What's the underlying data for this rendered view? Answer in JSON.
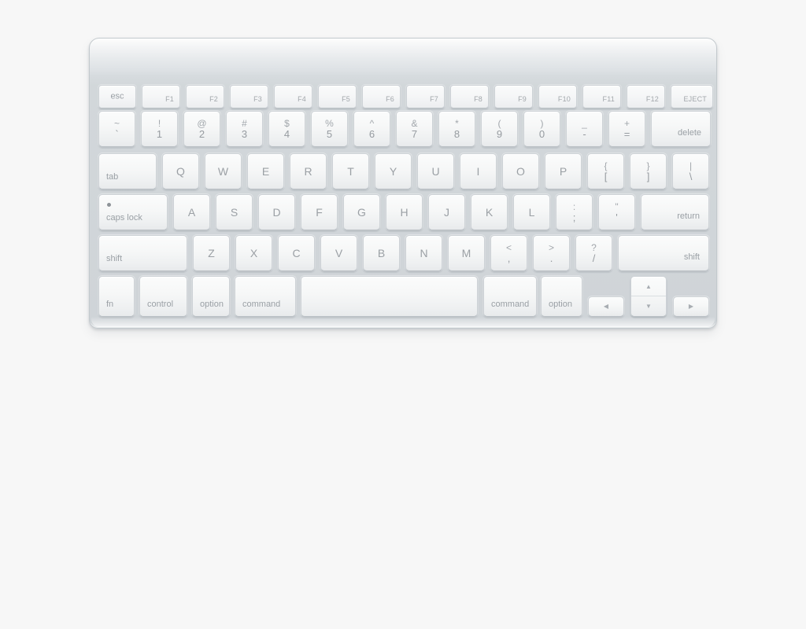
{
  "device": {
    "name": "apple-wireless-keyboard",
    "layout": "us-ansi-compact",
    "body_color": "#d2d7da",
    "key_color": "#f6f7f7",
    "legend_color": "#9aa0a5",
    "page_background": "#f7f7f7"
  },
  "rows": {
    "function_row": [
      {
        "name": "esc",
        "label": "esc",
        "style": "mid"
      },
      {
        "name": "f1",
        "label": "F1",
        "style": "br"
      },
      {
        "name": "f2",
        "label": "F2",
        "style": "br"
      },
      {
        "name": "f3",
        "label": "F3",
        "style": "br"
      },
      {
        "name": "f4",
        "label": "F4",
        "style": "br"
      },
      {
        "name": "f5",
        "label": "F5",
        "style": "br"
      },
      {
        "name": "f6",
        "label": "F6",
        "style": "br"
      },
      {
        "name": "f7",
        "label": "F7",
        "style": "br"
      },
      {
        "name": "f8",
        "label": "F8",
        "style": "br"
      },
      {
        "name": "f9",
        "label": "F9",
        "style": "br"
      },
      {
        "name": "f10",
        "label": "F10",
        "style": "br"
      },
      {
        "name": "f11",
        "label": "F11",
        "style": "br"
      },
      {
        "name": "f12",
        "label": "F12",
        "style": "br"
      },
      {
        "name": "eject",
        "label": "EJECT",
        "style": "br"
      }
    ],
    "number_row": [
      {
        "name": "backtick",
        "top": "~",
        "bottom": "`"
      },
      {
        "name": "digit-1",
        "top": "!",
        "bottom": "1"
      },
      {
        "name": "digit-2",
        "top": "@",
        "bottom": "2"
      },
      {
        "name": "digit-3",
        "top": "#",
        "bottom": "3"
      },
      {
        "name": "digit-4",
        "top": "$",
        "bottom": "4"
      },
      {
        "name": "digit-5",
        "top": "%",
        "bottom": "5"
      },
      {
        "name": "digit-6",
        "top": "^",
        "bottom": "6"
      },
      {
        "name": "digit-7",
        "top": "&",
        "bottom": "7"
      },
      {
        "name": "digit-8",
        "top": "*",
        "bottom": "8"
      },
      {
        "name": "digit-9",
        "top": "(",
        "bottom": "9"
      },
      {
        "name": "digit-0",
        "top": ")",
        "bottom": "0"
      },
      {
        "name": "minus",
        "top": "_",
        "bottom": "-"
      },
      {
        "name": "equals",
        "top": "+",
        "bottom": "="
      },
      {
        "name": "delete",
        "label": "delete",
        "style": "brw"
      }
    ],
    "top_row": [
      {
        "name": "tab",
        "label": "tab",
        "style": "bl"
      },
      {
        "name": "key-q",
        "label": "Q",
        "style": "center"
      },
      {
        "name": "key-w",
        "label": "W",
        "style": "center"
      },
      {
        "name": "key-e",
        "label": "E",
        "style": "center"
      },
      {
        "name": "key-r",
        "label": "R",
        "style": "center"
      },
      {
        "name": "key-t",
        "label": "T",
        "style": "center"
      },
      {
        "name": "key-y",
        "label": "Y",
        "style": "center"
      },
      {
        "name": "key-u",
        "label": "U",
        "style": "center"
      },
      {
        "name": "key-i",
        "label": "I",
        "style": "center"
      },
      {
        "name": "key-o",
        "label": "O",
        "style": "center"
      },
      {
        "name": "key-p",
        "label": "P",
        "style": "center"
      },
      {
        "name": "bracket-left",
        "top": "{",
        "bottom": "["
      },
      {
        "name": "bracket-right",
        "top": "}",
        "bottom": "]"
      },
      {
        "name": "backslash",
        "top": "|",
        "bottom": "\\"
      }
    ],
    "home_row": [
      {
        "name": "caps-lock",
        "label": "caps lock",
        "style": "bl",
        "indicator": true
      },
      {
        "name": "key-a",
        "label": "A",
        "style": "center"
      },
      {
        "name": "key-s",
        "label": "S",
        "style": "center"
      },
      {
        "name": "key-d",
        "label": "D",
        "style": "center"
      },
      {
        "name": "key-f",
        "label": "F",
        "style": "center"
      },
      {
        "name": "key-g",
        "label": "G",
        "style": "center"
      },
      {
        "name": "key-h",
        "label": "H",
        "style": "center"
      },
      {
        "name": "key-j",
        "label": "J",
        "style": "center"
      },
      {
        "name": "key-k",
        "label": "K",
        "style": "center"
      },
      {
        "name": "key-l",
        "label": "L",
        "style": "center"
      },
      {
        "name": "semicolon",
        "top": ":",
        "bottom": ";"
      },
      {
        "name": "quote",
        "top": "\"",
        "bottom": "'"
      },
      {
        "name": "return",
        "label": "return",
        "style": "brw"
      }
    ],
    "bottom_letter_row": [
      {
        "name": "shift-left",
        "label": "shift",
        "style": "bl"
      },
      {
        "name": "key-z",
        "label": "Z",
        "style": "center"
      },
      {
        "name": "key-x",
        "label": "X",
        "style": "center"
      },
      {
        "name": "key-c",
        "label": "C",
        "style": "center"
      },
      {
        "name": "key-v",
        "label": "V",
        "style": "center"
      },
      {
        "name": "key-b",
        "label": "B",
        "style": "center"
      },
      {
        "name": "key-n",
        "label": "N",
        "style": "center"
      },
      {
        "name": "key-m",
        "label": "M",
        "style": "center"
      },
      {
        "name": "comma",
        "top": "<",
        "bottom": ","
      },
      {
        "name": "period",
        "top": ">",
        "bottom": "."
      },
      {
        "name": "slash",
        "top": "?",
        "bottom": "/"
      },
      {
        "name": "shift-right",
        "label": "shift",
        "style": "brw"
      }
    ],
    "modifier_row": [
      {
        "name": "fn",
        "label": "fn",
        "style": "bl"
      },
      {
        "name": "control",
        "label": "control",
        "style": "bl"
      },
      {
        "name": "option-left",
        "label": "option",
        "style": "bl"
      },
      {
        "name": "command-left",
        "label": "command",
        "style": "bl"
      },
      {
        "name": "space",
        "label": "",
        "style": "none"
      },
      {
        "name": "command-right",
        "label": "command",
        "style": "bl"
      },
      {
        "name": "option-right",
        "label": "option",
        "style": "bl"
      }
    ],
    "arrow_cluster": [
      {
        "name": "arrow-left",
        "glyph": "◀"
      },
      {
        "name": "arrow-up",
        "glyph": "▲"
      },
      {
        "name": "arrow-down",
        "glyph": "▼"
      },
      {
        "name": "arrow-right",
        "glyph": "▶"
      }
    ]
  }
}
